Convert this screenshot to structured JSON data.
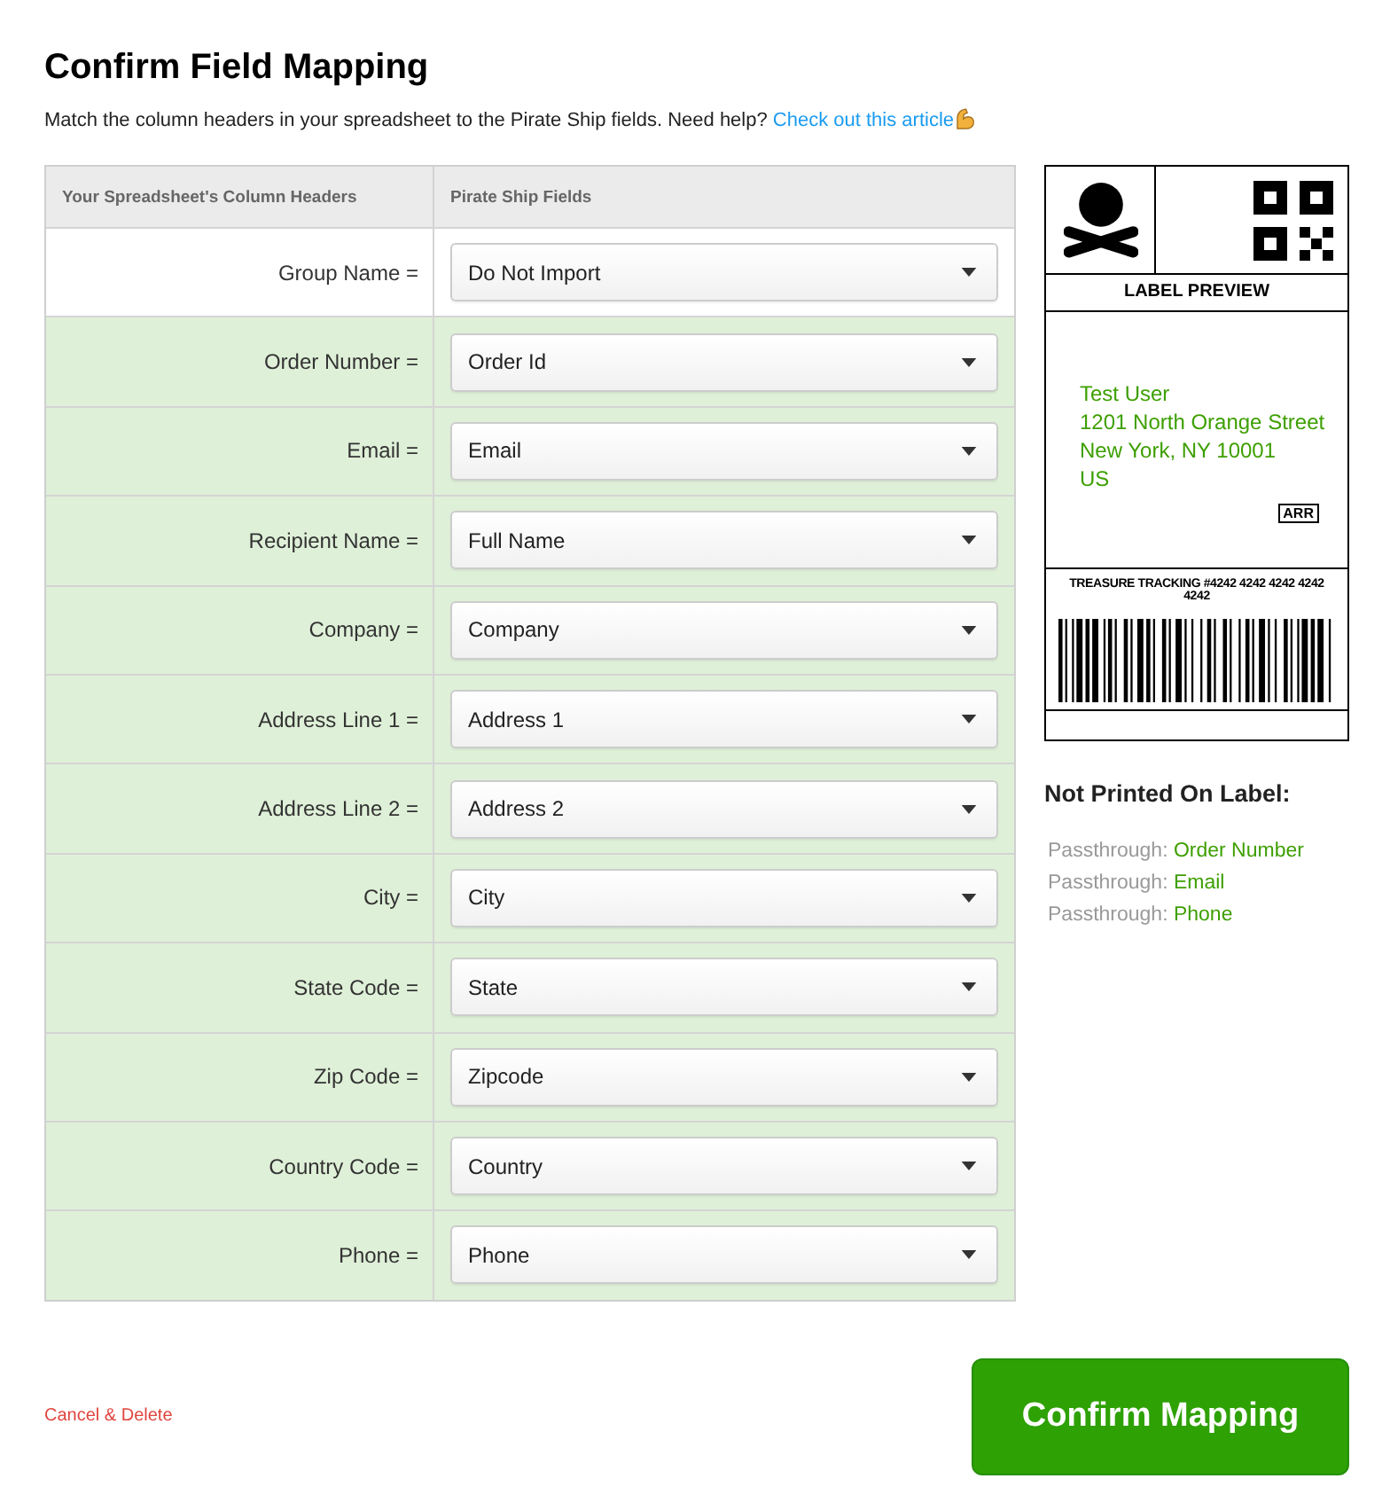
{
  "title": "Confirm Field Mapping",
  "intro": {
    "text": "Match the column headers in your spreadsheet to the Pirate Ship fields. Need help?",
    "link": "Check out this article"
  },
  "table": {
    "columns": [
      "Your Spreadsheet's Column Headers",
      "Pirate Ship Fields"
    ],
    "rows": [
      {
        "header": "Group Name =",
        "field": "Do Not Import",
        "mapped": false
      },
      {
        "header": "Order Number =",
        "field": "Order Id",
        "mapped": true
      },
      {
        "header": "Email =",
        "field": "Email",
        "mapped": true
      },
      {
        "header": "Recipient Name =",
        "field": "Full Name",
        "mapped": true
      },
      {
        "header": "Company =",
        "field": "Company",
        "mapped": true
      },
      {
        "header": "Address Line 1 =",
        "field": "Address 1",
        "mapped": true
      },
      {
        "header": "Address Line 2 =",
        "field": "Address 2",
        "mapped": true
      },
      {
        "header": "City =",
        "field": "City",
        "mapped": true
      },
      {
        "header": "State Code =",
        "field": "State",
        "mapped": true
      },
      {
        "header": "Zip Code =",
        "field": "Zipcode",
        "mapped": true
      },
      {
        "header": "Country Code =",
        "field": "Country",
        "mapped": true
      },
      {
        "header": "Phone =",
        "field": "Phone",
        "mapped": true
      }
    ]
  },
  "label_preview": {
    "title": "LABEL PREVIEW",
    "address": [
      "Test User",
      "1201 North Orange Street",
      "New York, NY 10001",
      "US"
    ],
    "service_code": "ARR",
    "tracking": "TREASURE TRACKING #4242 4242 4242 4242 4242"
  },
  "not_printed": {
    "title": "Not Printed On Label:",
    "items": [
      {
        "prefix": "Passthrough:",
        "field": "Order Number"
      },
      {
        "prefix": "Passthrough:",
        "field": "Email"
      },
      {
        "prefix": "Passthrough:",
        "field": "Phone"
      }
    ]
  },
  "actions": {
    "cancel": "Cancel & Delete",
    "confirm": "Confirm Mapping"
  }
}
